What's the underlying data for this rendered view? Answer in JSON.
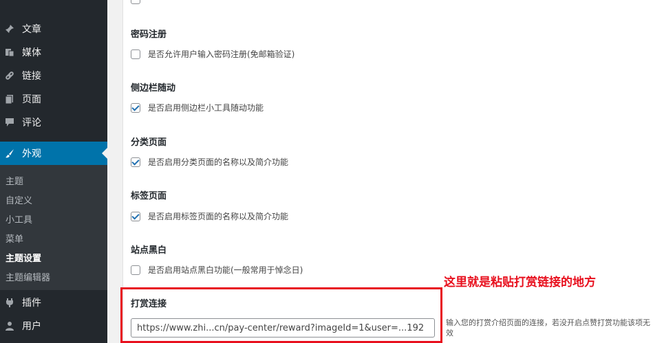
{
  "sidebar": {
    "items": [
      {
        "label": "文章",
        "icon": "pin-icon"
      },
      {
        "label": "媒体",
        "icon": "media-icon"
      },
      {
        "label": "链接",
        "icon": "link-icon"
      },
      {
        "label": "页面",
        "icon": "page-icon"
      },
      {
        "label": "评论",
        "icon": "comment-icon"
      },
      {
        "label": "外观",
        "icon": "brush-icon",
        "active": true
      },
      {
        "label": "插件",
        "icon": "plugin-icon"
      },
      {
        "label": "用户",
        "icon": "user-icon"
      }
    ],
    "submenu": [
      "主题",
      "自定义",
      "小工具",
      "菜单",
      "主题设置",
      "主题编辑器"
    ]
  },
  "settings": {
    "sections": [
      {
        "title": "密码注册",
        "checkbox_label": "是否允许用户输入密码注册(免邮箱验证)",
        "checked": false
      },
      {
        "title": "侧边栏随动",
        "checkbox_label": "是否启用侧边栏小工具随动功能",
        "checked": true
      },
      {
        "title": "分类页面",
        "checkbox_label": "是否启用分类页面的名称以及简介功能",
        "checked": true
      },
      {
        "title": "标签页面",
        "checkbox_label": "是否启用标签页面的名称以及简介功能",
        "checked": true
      },
      {
        "title": "站点黑白",
        "checkbox_label": "是否启用站点黑白功能(一般常用于悼念日)",
        "checked": false
      }
    ],
    "reward": {
      "title": "打赏连接",
      "input_value": "https://www.zhi...cn/pay-center/reward?imageId=1&user=...192",
      "help_text": "输入您的打赏介绍页面的连接，若没开启点赞打赏功能该项无效"
    }
  },
  "annotation": "这里就是粘贴打赏链接的地方",
  "colors": {
    "accent": "#0073aa",
    "highlight": "#e8101e",
    "sidebar_bg": "#23282d"
  }
}
